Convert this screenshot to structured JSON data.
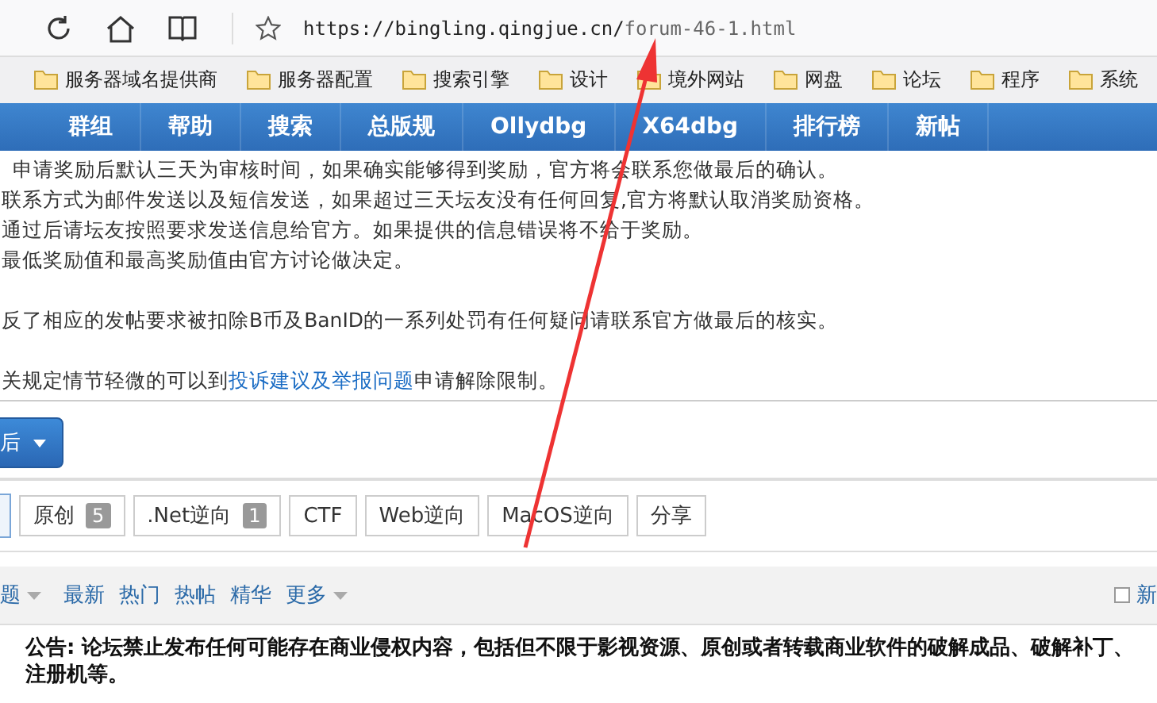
{
  "browser": {
    "url_host": "https://bingling.qingjue.cn/",
    "url_path": "forum-46-1.html"
  },
  "bookmarks": [
    "服务器域名提供商",
    "服务器配置",
    "搜索引擎",
    "设计",
    "境外网站",
    "网盘",
    "论坛",
    "程序",
    "系统"
  ],
  "nav": [
    "群组",
    "帮助",
    "搜索",
    "总版规",
    "Ollydbg",
    "X64dbg",
    "排行榜",
    "新帖"
  ],
  "notice": {
    "lines": [
      {
        "kind": "text",
        "text": "申请奖励后默认三天为审核时间，如果确实能够得到奖励，官方将会联系您做最后的确认。"
      },
      {
        "kind": "text",
        "text": "联系方式为邮件发送以及短信发送，如果超过三天坛友没有任何回复,官方将默认取消奖励资格。"
      },
      {
        "kind": "text",
        "text": "通过后请坛友按照要求发送信息给官方。如果提供的信息错误将不给于奖励。"
      },
      {
        "kind": "text",
        "text": "最低奖励值和最高奖励值由官方讨论做决定。"
      },
      {
        "kind": "blank"
      },
      {
        "kind": "text",
        "text": "反了相应的发帖要求被扣除B币及BanID的一系列处罚有任何疑问请联系官方做最后的核实。"
      },
      {
        "kind": "blank"
      },
      {
        "kind": "link",
        "before": "关规定情节轻微的可以到",
        "link": "投诉建议及举报问题",
        "after": "申请解除限制。"
      }
    ]
  },
  "post_button": {
    "label": "后"
  },
  "tags": [
    {
      "label": "原创",
      "count": "5"
    },
    {
      "label": ".Net逆向",
      "count": "1"
    },
    {
      "label": "CTF"
    },
    {
      "label": "Web逆向"
    },
    {
      "label": "MacOS逆向"
    },
    {
      "label": "分享"
    }
  ],
  "filter": {
    "sort": "题",
    "links": [
      "最新",
      "热门",
      "热帖",
      "精华"
    ],
    "more": "更多",
    "new_window": {
      "label": "新",
      "checked": false
    }
  },
  "announcement": "公告: 论坛禁止发布任何可能存在商业侵权内容，包括但不限于影视资源、原创或者转载商业软件的破解成品、破解补丁、注册机等。"
}
